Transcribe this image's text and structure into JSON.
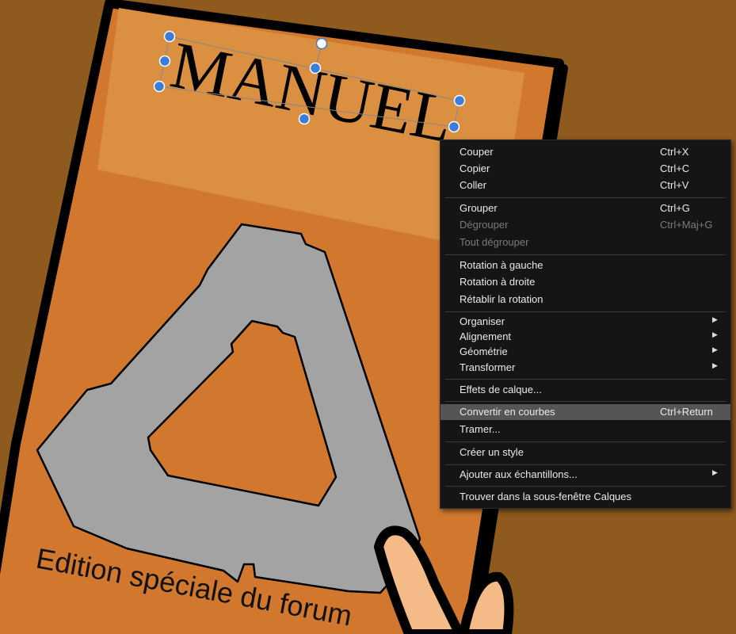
{
  "canvas": {
    "title_text": "MANUEL",
    "footer_text": "Edition spéciale du forum",
    "colors": {
      "background": "#8e5a1e",
      "book_cover": "#d2782e",
      "title_band": "#da9040",
      "logo": "#a3a3a3",
      "selection_handle": "#3b7dd8"
    }
  },
  "context_menu": {
    "items": [
      {
        "label": "Couper",
        "shortcut": "Ctrl+X",
        "enabled": true
      },
      {
        "label": "Copier",
        "shortcut": "Ctrl+C",
        "enabled": true
      },
      {
        "label": "Coller",
        "shortcut": "Ctrl+V",
        "enabled": true
      },
      {
        "label": "Grouper",
        "shortcut": "Ctrl+G",
        "enabled": true
      },
      {
        "label": "Dégrouper",
        "shortcut": "Ctrl+Maj+G",
        "enabled": false
      },
      {
        "label": "Tout dégrouper",
        "shortcut": "",
        "enabled": false
      },
      {
        "label": "Rotation à gauche",
        "shortcut": "",
        "enabled": true
      },
      {
        "label": "Rotation à droite",
        "shortcut": "",
        "enabled": true
      },
      {
        "label": "Rétablir la rotation",
        "shortcut": "",
        "enabled": true
      },
      {
        "label": "Organiser",
        "submenu": true,
        "enabled": true
      },
      {
        "label": "Alignement",
        "submenu": true,
        "enabled": true
      },
      {
        "label": "Géométrie",
        "submenu": true,
        "enabled": true
      },
      {
        "label": "Transformer",
        "submenu": true,
        "enabled": true
      },
      {
        "label": "Effets de calque...",
        "shortcut": "",
        "enabled": true
      },
      {
        "label": "Convertir en courbes",
        "shortcut": "Ctrl+Return",
        "enabled": true,
        "highlighted": true
      },
      {
        "label": "Tramer...",
        "shortcut": "",
        "enabled": true
      },
      {
        "label": "Créer un style",
        "shortcut": "",
        "enabled": true
      },
      {
        "label": "Ajouter aux échantillons...",
        "submenu": true,
        "enabled": true
      },
      {
        "label": "Trouver dans la sous-fenêtre Calques",
        "shortcut": "",
        "enabled": true
      }
    ]
  }
}
